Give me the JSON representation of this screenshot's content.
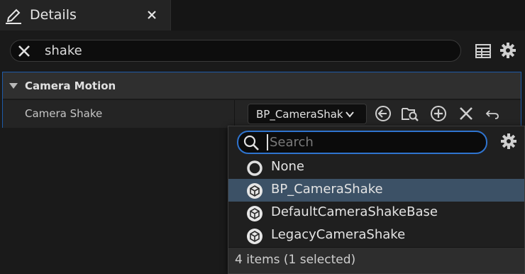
{
  "window": {
    "tab_title": "Details",
    "tab_icon": "edit-pencil-icon",
    "close_icon": "close-icon"
  },
  "search": {
    "value": "shake",
    "clear_icon": "clear-x-icon",
    "toolbar_icons": [
      "table-view-icon",
      "settings-gear-icon"
    ]
  },
  "category": {
    "label": "Camera Motion",
    "expanded": true
  },
  "property": {
    "name": "Camera Shake",
    "value": "BP_CameraShake",
    "value_display": "BP_CameraShak",
    "buttons": [
      "use-selected-icon",
      "browse-asset-icon",
      "add-icon",
      "clear-icon",
      "reset-icon"
    ]
  },
  "dropdown": {
    "search_placeholder": "Search",
    "search_value": "",
    "items": [
      {
        "label": "None",
        "icon": "none-circle-icon",
        "selected": false
      },
      {
        "label": "BP_CameraShake",
        "icon": "class-cube-icon",
        "selected": true
      },
      {
        "label": "DefaultCameraShakeBase",
        "icon": "class-cube-icon",
        "selected": false
      },
      {
        "label": "LegacyCameraShake",
        "icon": "class-cube-icon",
        "selected": false
      }
    ],
    "footer": "4 items (1 selected)"
  },
  "colors": {
    "accent": "#2f74cf",
    "selection": "#3c5166",
    "focus_border": "#1e5aa8"
  }
}
